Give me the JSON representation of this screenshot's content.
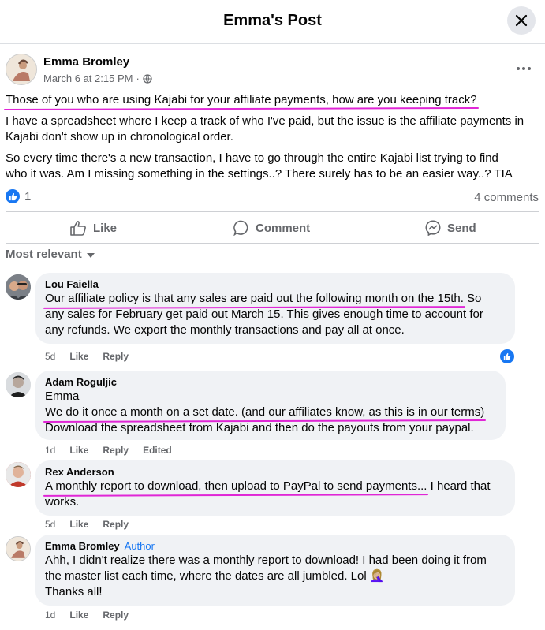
{
  "header": {
    "title": "Emma's Post"
  },
  "post": {
    "author": "Emma Bromley",
    "time": "March 6 at 2:15 PM",
    "separator": "·",
    "paragraph1": "Those of you who are using Kajabi for your affiliate payments, how are you keeping track?",
    "paragraph2_line1": "I have a spreadsheet where I keep a track of who I've paid, but the issue is the affiliate payments in",
    "paragraph2_line2": "Kajabi don't show up in chronological order.",
    "paragraph3_line1": "So every time there's a new transaction, I have to go through the entire Kajabi list trying to find",
    "paragraph3_line2": "who it was. Am I missing something in the settings..? There surely has to be an easier way..? TIA",
    "reaction_count": "1",
    "comments_count": "4 comments"
  },
  "actions": {
    "like": "Like",
    "comment": "Comment",
    "send": "Send"
  },
  "sort_label": "Most relevant",
  "comments": [
    {
      "name": "Lou Faiella",
      "line1_hl": "Our affiliate policy is that any sales are paid out the following month on the 15th.",
      "line1_rest": " So",
      "line2": "any sales for February get paid out March 15. This gives enough time to account for",
      "line3": "any refunds. We export the monthly transactions and pay all at once.",
      "time": "5d",
      "like": "Like",
      "reply": "Reply"
    },
    {
      "name": "Adam Roguljic",
      "line1": "Emma",
      "line2_hl": "We do it once a month on a set date. (and our affiliates know, as this is in our terms)",
      "line3": "Download the spreadsheet from Kajabi and then do the payouts from your paypal.",
      "time": "1d",
      "like": "Like",
      "reply": "Reply",
      "edited": "Edited"
    },
    {
      "name": "Rex Anderson",
      "line1_hl": "A monthly report to download, then upload to PayPal to send payments...",
      "line1_rest": " I heard that",
      "line2": "works.",
      "time": "5d",
      "like": "Like",
      "reply": "Reply"
    },
    {
      "name": "Emma Bromley",
      "badge": "Author",
      "line1": "Ahh, I didn't realize there was a monthly report to download! I had been doing it from",
      "line2": "the master list each time, where the dates are all jumbled. Lol 🤦🏼‍♀️",
      "line3": "Thanks all!",
      "time": "1d",
      "like": "Like",
      "reply": "Reply"
    }
  ],
  "icons": {
    "close": "close-icon",
    "more": "more-options-icon",
    "audience": "globe-icon",
    "like": "thumbs-up-icon",
    "comment": "speech-bubble-icon",
    "send": "messenger-icon",
    "reaction": "like-reaction-icon",
    "sort": "chevron-down-icon"
  },
  "colors": {
    "accent": "#1877f2",
    "highlight": "#e026d6",
    "bubble": "#f0f2f5",
    "muted": "#65676b"
  }
}
